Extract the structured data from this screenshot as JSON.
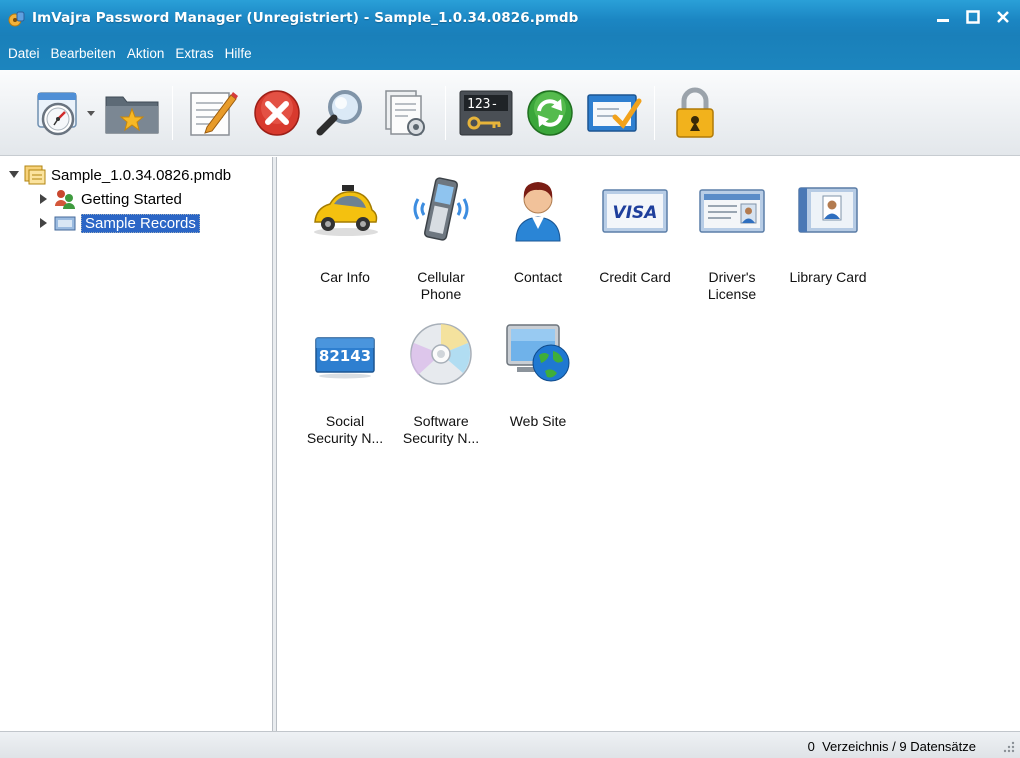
{
  "window": {
    "title": "ImVajra Password Manager (Unregistriert) - Sample_1.0.34.0826.pmdb",
    "controls": [
      "minimize-icon",
      "maximize-icon",
      "close-icon"
    ]
  },
  "menu": {
    "items": [
      "Datei",
      "Bearbeiten",
      "Aktion",
      "Extras",
      "Hilfe"
    ]
  },
  "toolbar": {
    "buttons": [
      "new-record-icon",
      "favorites-folder-icon",
      "edit-icon",
      "delete-icon",
      "search-icon",
      "preview-icon",
      "password-generator-icon",
      "sync-icon",
      "autofill-icon",
      "lock-icon"
    ]
  },
  "tree": {
    "root": "Sample_1.0.34.0826.pmdb",
    "children": [
      {
        "label": "Getting Started",
        "icon": "users-icon"
      },
      {
        "label": "Sample Records",
        "icon": "records-folder-icon",
        "selected": true
      }
    ]
  },
  "content": {
    "items": [
      {
        "label": "Car Info",
        "icon": "car-icon"
      },
      {
        "label": "Cellular Phone",
        "icon": "cellphone-icon"
      },
      {
        "label": "Contact",
        "icon": "contact-icon"
      },
      {
        "label": "Credit Card",
        "icon": "credit-card-icon",
        "badge": "VISA"
      },
      {
        "label": "Driver's License",
        "icon": "drivers-license-icon"
      },
      {
        "label": "Library Card",
        "icon": "library-card-icon"
      },
      {
        "label": "Social Security N...",
        "icon": "social-security-icon",
        "badge": "82143"
      },
      {
        "label": "Software Security N...",
        "icon": "software-cd-icon"
      },
      {
        "label": "Web Site",
        "icon": "website-globe-icon"
      }
    ]
  },
  "status": {
    "text": "0  Verzeichnis / 9 Datensätze"
  },
  "toolbar_badge": "123-",
  "colors": {
    "titlebar": "#1b86c3",
    "selection": "#2b66c6"
  }
}
